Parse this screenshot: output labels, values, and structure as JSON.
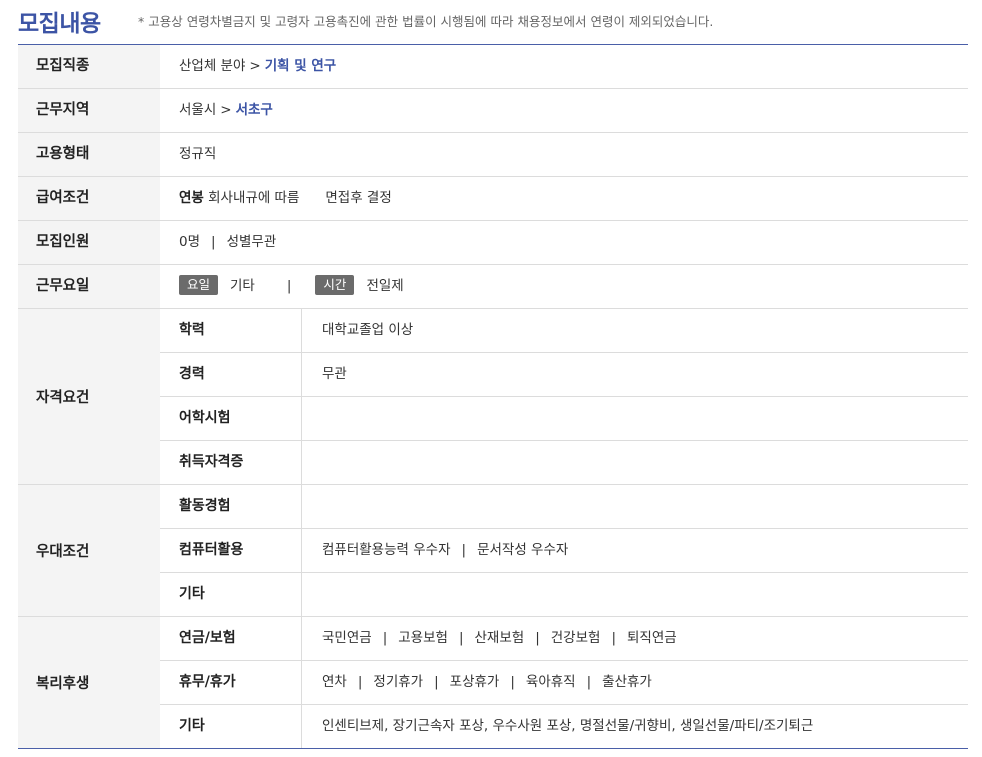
{
  "header": {
    "title": "모집내용",
    "notice": "* 고용상 연령차별금지 및 고령자 고용촉진에 관한 법률이 시행됨에 따라 채용정보에서 연령이 제외되었습니다."
  },
  "rows": {
    "job": {
      "label": "모집직종",
      "category": "산업체 분야",
      "separator": ">",
      "highlight": "기획 및 연구"
    },
    "location": {
      "label": "근무지역",
      "city": "서울시",
      "separator": ">",
      "highlight": "서초구"
    },
    "employment": {
      "label": "고용형태",
      "value": "정규직"
    },
    "salary": {
      "label": "급여조건",
      "prefix": "연봉",
      "value": "회사내규에 따름",
      "extra": "면접후 결정"
    },
    "recruit": {
      "label": "모집인원",
      "count": "0명",
      "pipe": "|",
      "gender": "성별무관"
    },
    "workdays": {
      "label": "근무요일",
      "day_badge": "요일",
      "day_value": "기타",
      "pipe": "|",
      "time_badge": "시간",
      "time_value": "전일제"
    }
  },
  "qualification": {
    "label": "자격요건",
    "items": [
      {
        "label": "학력",
        "value": "대학교졸업 이상"
      },
      {
        "label": "경력",
        "value": "무관"
      },
      {
        "label": "어학시험",
        "value": ""
      },
      {
        "label": "취득자격증",
        "value": ""
      }
    ]
  },
  "preference": {
    "label": "우대조건",
    "activity": {
      "label": "활동경험",
      "value": ""
    },
    "computer": {
      "label": "컴퓨터활용",
      "values": [
        "컴퓨터활용능력 우수자",
        "문서작성 우수자"
      ]
    },
    "other": {
      "label": "기타",
      "value": ""
    }
  },
  "welfare": {
    "label": "복리후생",
    "insurance": {
      "label": "연금/보험",
      "values": [
        "국민연금",
        "고용보험",
        "산재보험",
        "건강보험",
        "퇴직연금"
      ]
    },
    "leave": {
      "label": "휴무/휴가",
      "values": [
        "연차",
        "정기휴가",
        "포상휴가",
        "육아휴직",
        "출산휴가"
      ]
    },
    "other": {
      "label": "기타",
      "value": "인센티브제, 장기근속자 포상, 우수사원 포상, 명절선물/귀향비, 생일선물/파티/조기퇴근"
    }
  },
  "pipe_char": "|"
}
